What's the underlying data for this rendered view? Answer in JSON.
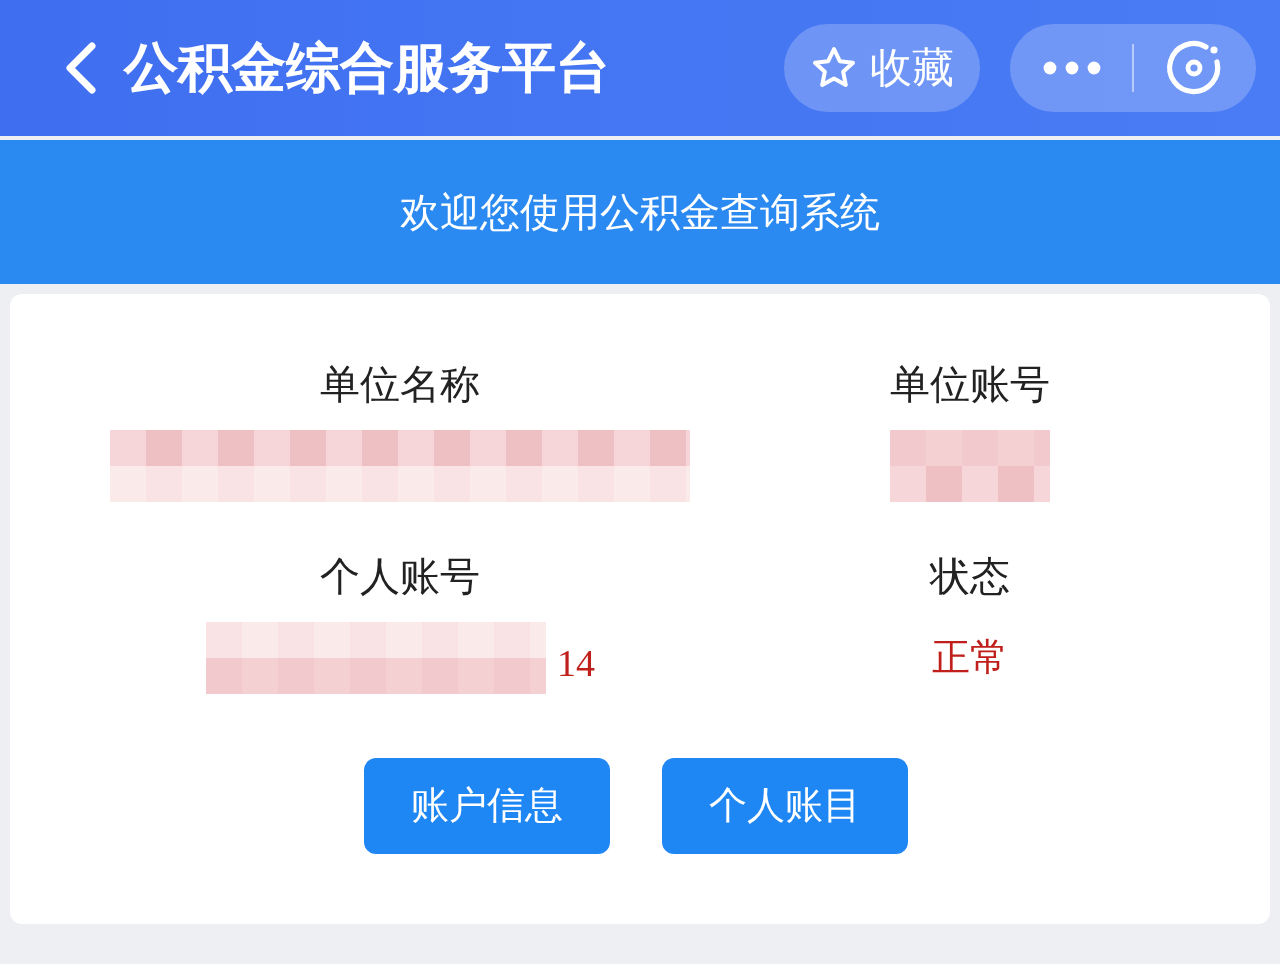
{
  "header": {
    "title": "公积金综合服务平台",
    "favorite_label": "收藏"
  },
  "banner": {
    "text": "欢迎您使用公积金查询系统"
  },
  "fields": [
    {
      "label": "单位名称",
      "redacted": true
    },
    {
      "label": "单位账号",
      "redacted": true
    },
    {
      "label": "个人账号",
      "redacted": true,
      "value": "14"
    },
    {
      "label": "状态",
      "value": "正常"
    }
  ],
  "buttons": [
    "账户信息",
    "个人账目"
  ]
}
